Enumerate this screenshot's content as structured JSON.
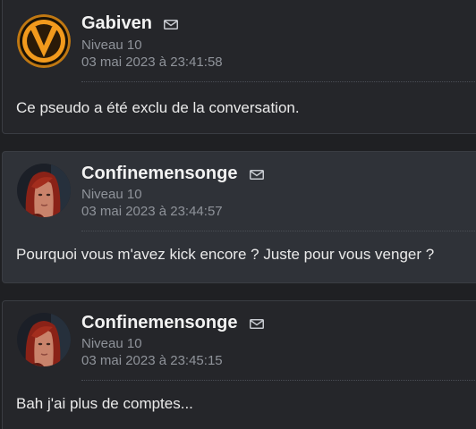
{
  "posts": [
    {
      "username": "Gabiven",
      "level": "Niveau 10",
      "date": "03 mai 2023 à 23:41:58",
      "message": "Ce pseudo a été exclu de la conversation.",
      "avatar_icon": "vault-logo-icon"
    },
    {
      "username": "Confinemensonge",
      "level": "Niveau 10",
      "date": "03 mai 2023 à 23:44:57",
      "message": "Pourquoi vous m'avez kick encore ? Juste pour vous venger ?",
      "avatar_icon": "red-hair-woman-avatar-icon"
    },
    {
      "username": "Confinemensonge",
      "level": "Niveau 10",
      "date": "03 mai 2023 à 23:45:15",
      "message": "Bah j'ai plus de comptes...",
      "avatar_icon": "red-hair-woman-avatar-icon"
    }
  ],
  "colors": {
    "page_bg": "#1f2023",
    "post_dark_bg": "#25262a",
    "post_light_bg": "#2f3238",
    "username": "#f2f2f2",
    "meta": "#8f939a",
    "message": "#eaeaea",
    "vault_orange": "#f29a1d"
  }
}
